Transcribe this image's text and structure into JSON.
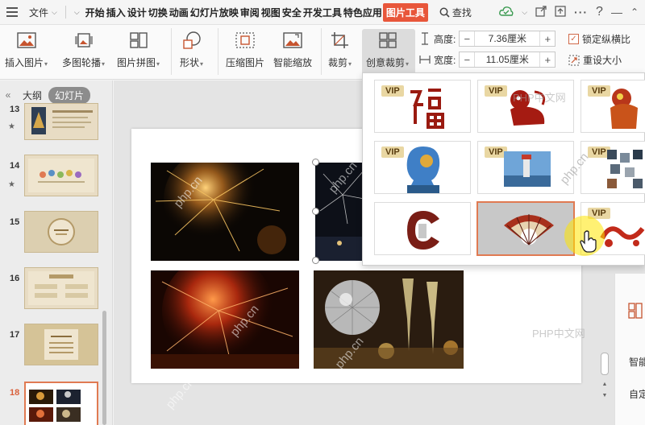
{
  "menubar": {
    "file_label": "文件",
    "tabs": [
      {
        "label": "开始"
      },
      {
        "label": "插入"
      },
      {
        "label": "设计"
      },
      {
        "label": "切换"
      },
      {
        "label": "动画"
      },
      {
        "label": "幻灯片放映"
      },
      {
        "label": "审阅"
      },
      {
        "label": "视图"
      },
      {
        "label": "安全"
      },
      {
        "label": "开发工具"
      },
      {
        "label": "特色应用"
      }
    ],
    "active_tab": "图片工具",
    "search_label": "查找"
  },
  "ribbon": {
    "insert_picture": "插入图片",
    "multi_outline": "多图轮播",
    "picture_collage": "图片拼图",
    "shape": "形状",
    "compress_picture": "压缩图片",
    "smart_zoom": "智能缩放",
    "crop": "裁剪",
    "creative_crop": "创意裁剪",
    "height_label": "高度:",
    "height_value": "7.36厘米",
    "width_label": "宽度:",
    "width_value": "11.05厘米",
    "lock_ratio": "锁定纵横比",
    "reset_size": "重设大小"
  },
  "leftpanel": {
    "tab_outline": "大纲",
    "tab_slides": "幻灯片",
    "slides": [
      {
        "num": "13",
        "star": true
      },
      {
        "num": "14",
        "star": true
      },
      {
        "num": "15",
        "star": false
      },
      {
        "num": "16",
        "star": false
      },
      {
        "num": "17",
        "star": false
      },
      {
        "num": "18",
        "star": false
      }
    ]
  },
  "dropdown": {
    "vip_label": "VIP"
  },
  "right_panel": {
    "smart": "智能",
    "custom": "自定"
  },
  "watermarks": {
    "site": "php.cn",
    "site_cn": "PHP中文网"
  },
  "colors": {
    "accent": "#e8563a",
    "selection_border": "#e07a52",
    "vip_bg": "#e9d7a3"
  }
}
